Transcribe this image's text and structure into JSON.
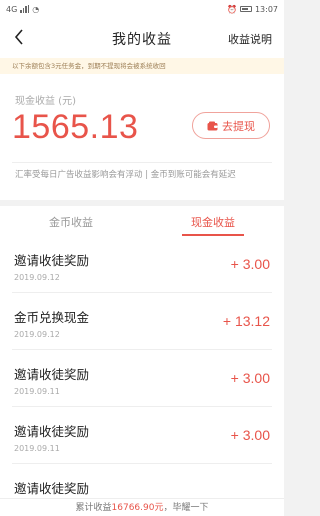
{
  "status_bar": {
    "time": "13:07",
    "signal": "4G"
  },
  "header": {
    "title": "我的收益",
    "right_link": "收益说明"
  },
  "notice": "以下余额包含3元任务金，到期不提现将会被系统收回",
  "summary": {
    "label": "现金收益 (元)",
    "amount": "1565.13",
    "withdraw_label": "去提现",
    "note": "汇率受每日广告收益影响会有浮动 | 金币到账可能会有延迟"
  },
  "tabs": [
    {
      "label": "金币收益",
      "active": false
    },
    {
      "label": "现金收益",
      "active": true
    }
  ],
  "records": [
    {
      "title": "邀请收徒奖励",
      "date": "2019.09.12",
      "amount": "+ 3.00"
    },
    {
      "title": "金币兑换现金",
      "date": "2019.09.12",
      "amount": "+ 13.12"
    },
    {
      "title": "邀请收徒奖励",
      "date": "2019.09.11",
      "amount": "+ 3.00"
    },
    {
      "title": "邀请收徒奖励",
      "date": "2019.09.11",
      "amount": "+ 3.00"
    },
    {
      "title": "邀请收徒奖励",
      "date": "",
      "amount": ""
    }
  ],
  "footer": {
    "prefix": "累计收益",
    "total": "16766.90元",
    "suffix": "，毕耀一下"
  },
  "colors": {
    "accent": "#e8544a",
    "notice_bg": "#fff7e6"
  }
}
